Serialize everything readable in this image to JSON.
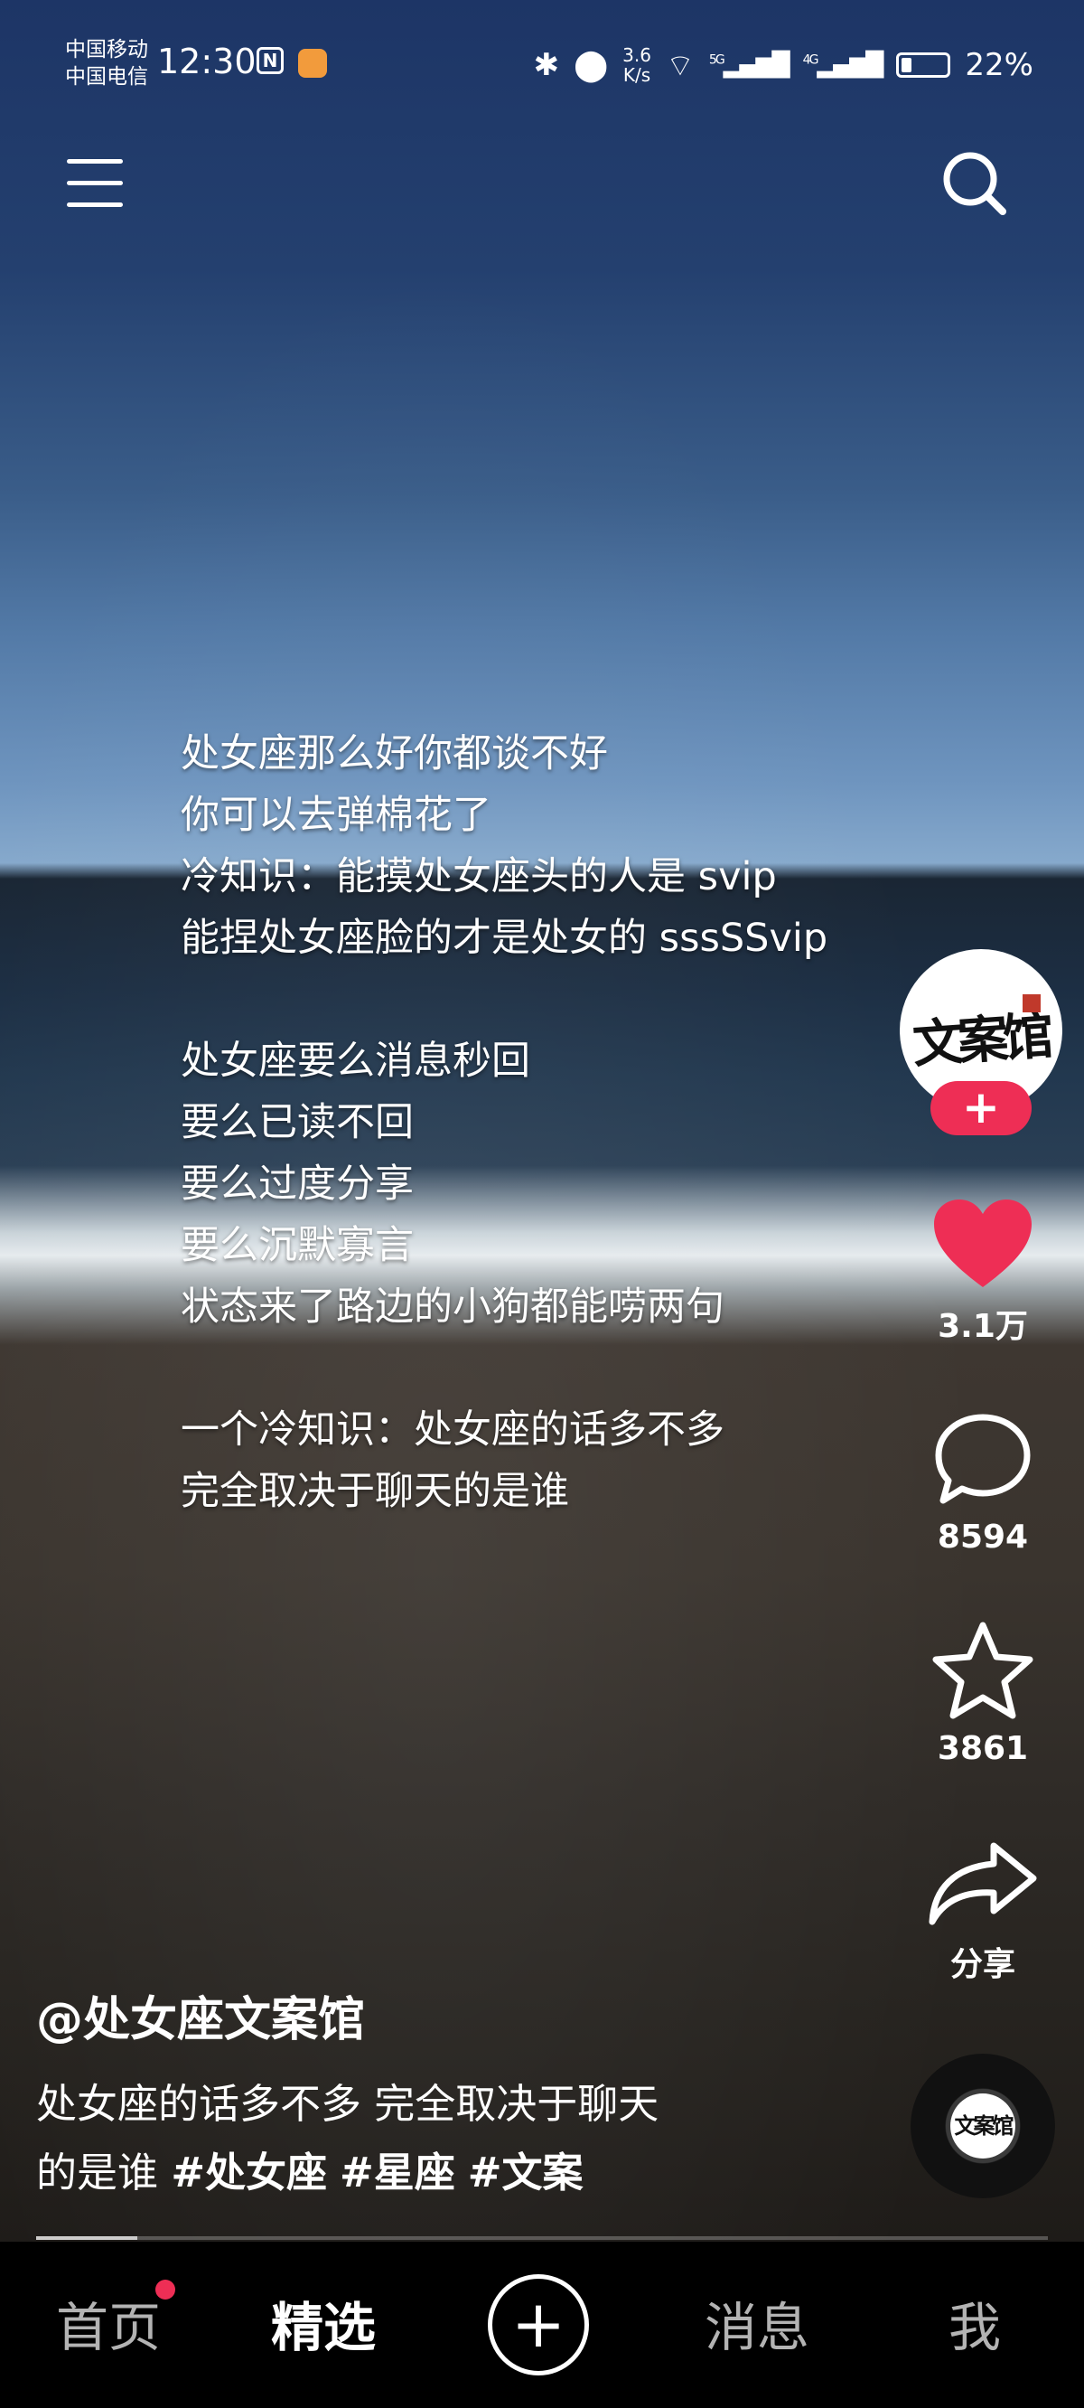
{
  "status_bar": {
    "carrier_1": "中国移动",
    "carrier_2": "中国电信",
    "time": "12:30",
    "net_speed_value": "3.6",
    "net_speed_unit": "K/s",
    "signal_1": "5G",
    "signal_2": "4G",
    "battery": "22%",
    "battery_level": 0.22
  },
  "header": {
    "menu_icon": "menu-icon",
    "search_icon": "search-icon"
  },
  "lyrics": [
    "处女座那么好你都谈不好",
    "你可以去弹棉花了",
    "冷知识：能摸处女座头的人是 svip",
    "能捏处女座脸的才是处女的 sssSSvip",
    "",
    "处女座要么消息秒回",
    "要么已读不回",
    "要么过度分享",
    "要么沉默寡言",
    "状态来了路边的小狗都能唠两句",
    "",
    "一个冷知识：处女座的话多不多",
    "完全取决于聊天的是谁"
  ],
  "right_rail": {
    "avatar_text": "文案馆",
    "follow_label": "+",
    "likes": "3.1万",
    "comments": "8594",
    "favorites": "3861",
    "share_label": "分享",
    "music_text": "文案馆",
    "like_color": "#ee2e55"
  },
  "post": {
    "author": "@处女座文案馆",
    "caption_line_1": "处女座的话多不多 完全取决于聊天",
    "caption_line_2": "的是谁",
    "tags": [
      "#处女座",
      "#星座",
      "#文案"
    ],
    "progress": 0.1
  },
  "tab_bar": {
    "home": "首页",
    "featured": "精选",
    "add": "+",
    "messages": "消息",
    "me": "我",
    "active_tab": "精选"
  }
}
